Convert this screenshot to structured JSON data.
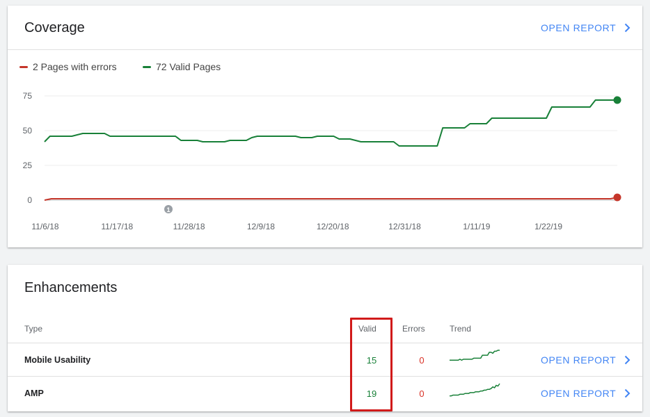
{
  "coverage": {
    "title": "Coverage",
    "open_report_label": "OPEN REPORT",
    "legend": [
      {
        "label": "2 Pages with errors",
        "color": "#c5362a"
      },
      {
        "label": "72 Valid Pages",
        "color": "#188038"
      }
    ],
    "annotation_marker": "1"
  },
  "chart_data": {
    "type": "line",
    "x_tick_labels": [
      "11/6/18",
      "11/17/18",
      "11/28/18",
      "12/9/18",
      "12/20/18",
      "12/31/18",
      "1/11/19",
      "1/22/19"
    ],
    "y_tick_labels": [
      "0",
      "25",
      "50",
      "75"
    ],
    "ylim": [
      0,
      75
    ],
    "grid": true,
    "legend_position": "top-left",
    "series": [
      {
        "name": "Pages with errors",
        "color": "#c5362a",
        "values": [
          0,
          1,
          1,
          1,
          1,
          1,
          1,
          1,
          1,
          1,
          1,
          1,
          1,
          1,
          1,
          1,
          1,
          1,
          1,
          1,
          1,
          1,
          1,
          1,
          1,
          1,
          1,
          1,
          1,
          1,
          1,
          1,
          1,
          1,
          1,
          1,
          1,
          1,
          1,
          1,
          1,
          1,
          1,
          1,
          1,
          1,
          1,
          1,
          1,
          1,
          1,
          1,
          1,
          1,
          1,
          1,
          1,
          1,
          1,
          1,
          1,
          1,
          1,
          1,
          1,
          1,
          1,
          1,
          1,
          1,
          1,
          1,
          1,
          1,
          1,
          1,
          1,
          1,
          1,
          1,
          1,
          1,
          1,
          1,
          1,
          2
        ]
      },
      {
        "name": "Valid Pages",
        "color": "#188038",
        "values": [
          42,
          46,
          46,
          46,
          46,
          46,
          47,
          48,
          48,
          48,
          48,
          48,
          46,
          46,
          46,
          46,
          46,
          46,
          46,
          46,
          46,
          46,
          46,
          46,
          46,
          43,
          43,
          43,
          43,
          42,
          42,
          42,
          42,
          42,
          43,
          43,
          43,
          43,
          45,
          46,
          46,
          46,
          46,
          46,
          46,
          46,
          46,
          45,
          45,
          45,
          46,
          46,
          46,
          46,
          44,
          44,
          44,
          43,
          42,
          42,
          42,
          42,
          42,
          42,
          42,
          39,
          39,
          39,
          39,
          39,
          39,
          39,
          39,
          52,
          52,
          52,
          52,
          52,
          55,
          55,
          55,
          55,
          59,
          59,
          59,
          59,
          59,
          59,
          59,
          59,
          59,
          59,
          59,
          67,
          67,
          67,
          67,
          67,
          67,
          67,
          67,
          72,
          72,
          72,
          72,
          72
        ]
      }
    ]
  },
  "enhancements": {
    "title": "Enhancements",
    "columns": {
      "type": "Type",
      "valid": "Valid",
      "errors": "Errors",
      "trend": "Trend"
    },
    "rows": [
      {
        "type": "Mobile Usability",
        "valid": "15",
        "errors": "0",
        "open_report_label": "OPEN REPORT",
        "trend": [
          4,
          4,
          4,
          4,
          4,
          4,
          5,
          4,
          5,
          5,
          5,
          5,
          5,
          5,
          6,
          6,
          6,
          6,
          6,
          9,
          9,
          9,
          9,
          12,
          12,
          11,
          13,
          13,
          14,
          14
        ]
      },
      {
        "type": "AMP",
        "valid": "19",
        "errors": "0",
        "open_report_label": "OPEN REPORT",
        "trend": [
          2,
          2,
          3,
          3,
          3,
          3,
          4,
          4,
          4,
          5,
          5,
          5,
          6,
          6,
          6,
          7,
          7,
          7,
          8,
          8,
          9,
          9,
          10,
          10,
          11,
          13,
          12,
          15,
          14,
          17
        ]
      }
    ]
  },
  "colors": {
    "accent": "#4285f4",
    "valid": "#188038",
    "error": "#d93025",
    "highlight_box": "#d11a1a"
  }
}
